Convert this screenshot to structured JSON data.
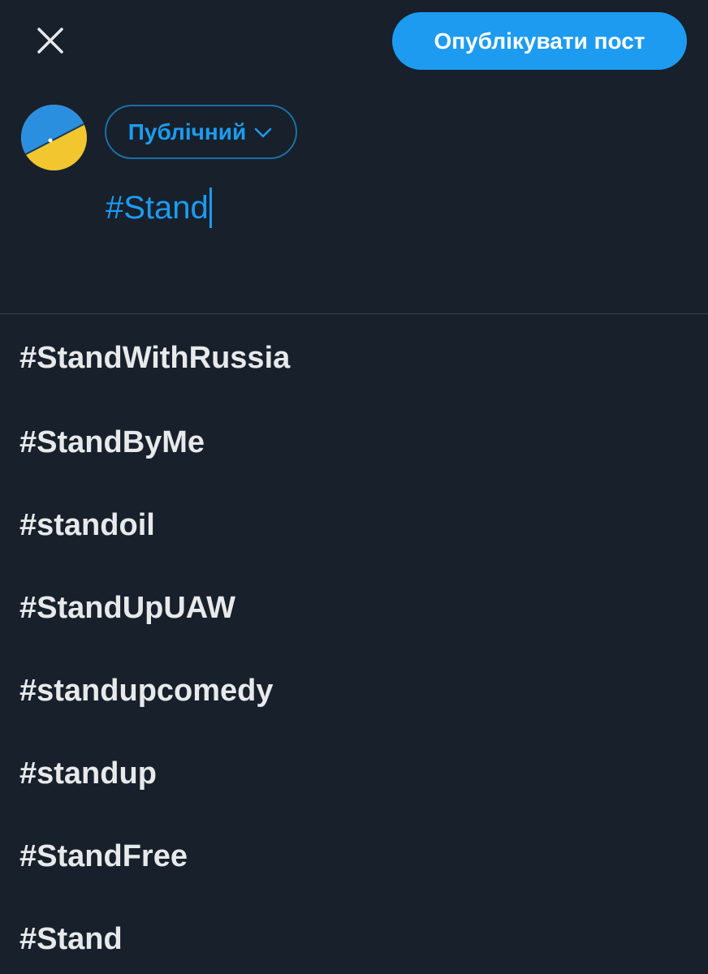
{
  "header": {
    "close_icon": "close-icon",
    "publish_label": "Опублікувати пост"
  },
  "composer": {
    "avatar_icon": "ukraine-flag-avatar",
    "audience_label": "Публічний",
    "audience_icon": "chevron-down-icon",
    "text": "#Stand"
  },
  "colors": {
    "background": "#17202b",
    "accent": "#1d9bf0",
    "text": "#e7e9ea",
    "divider": "#38444d"
  },
  "suggestions": [
    "#StandWithRussia",
    "#StandByMe",
    "#standoil",
    "#StandUpUAW",
    "#standupcomedy",
    "#standup",
    "#StandFree",
    "#Stand"
  ]
}
